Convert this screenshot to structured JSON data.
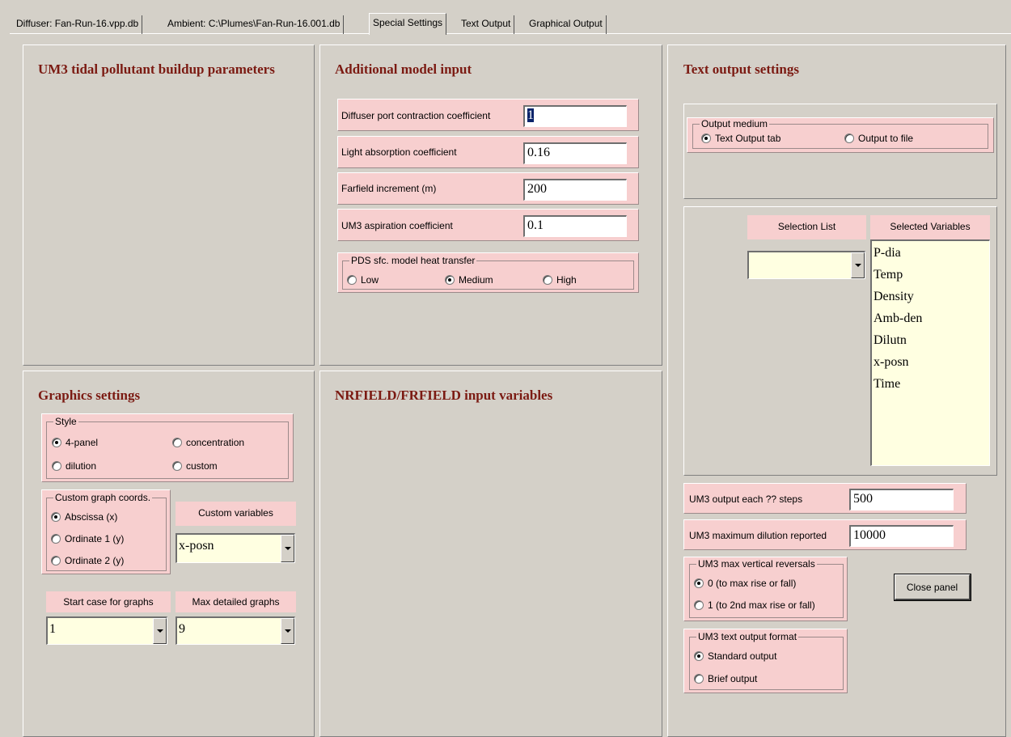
{
  "tabs": [
    {
      "label": "Diffuser: Fan-Run-16.vpp.db"
    },
    {
      "label": "Ambient: C:\\Plumes\\Fan-Run-16.001.db"
    },
    {
      "label": "Special Settings"
    },
    {
      "label": "Text Output"
    },
    {
      "label": "Graphical Output"
    }
  ],
  "um3_tidal": {
    "title": "UM3 tidal pollutant buildup parameters"
  },
  "additional": {
    "title": "Additional model input",
    "fields": [
      {
        "label": "Diffuser port contraction coefficient",
        "value": "1"
      },
      {
        "label": "Light absorption coefficient",
        "value": "0.16"
      },
      {
        "label": "Farfield increment (m)",
        "value": "200"
      },
      {
        "label": "UM3 aspiration coefficient",
        "value": "0.1"
      }
    ],
    "heat": {
      "legend": "PDS sfc. model heat transfer",
      "options": [
        "Low",
        "Medium",
        "High"
      ],
      "selected": "Medium"
    }
  },
  "text_output": {
    "title": "Text output settings",
    "medium": {
      "legend": "Output medium",
      "options": [
        "Text Output tab",
        "Output to file"
      ],
      "selected": "Text Output tab"
    },
    "selection_list_label": "Selection List",
    "selection_list_value": "",
    "selected_variables_label": "Selected Variables",
    "selected_variables": [
      "P-dia",
      "Temp",
      "Density",
      "Amb-den",
      "Dilutn",
      "x-posn",
      "Time"
    ],
    "steps": {
      "label": "UM3 output each ?? steps",
      "value": "500"
    },
    "max_dilution": {
      "label": "UM3 maximum dilution reported",
      "value": "10000"
    },
    "reversals": {
      "legend": "UM3 max vertical reversals",
      "options": [
        "0 (to max rise or fall)",
        "1 (to 2nd max rise or fall)"
      ],
      "selected": "0 (to max rise or fall)"
    },
    "format": {
      "legend": "UM3 text output format",
      "options": [
        "Standard output",
        "Brief output"
      ],
      "selected": "Standard output"
    },
    "close_label": "Close panel"
  },
  "graphics": {
    "title": "Graphics settings",
    "style": {
      "legend": "Style",
      "options": [
        "4-panel",
        "concentration",
        "dilution",
        "custom"
      ],
      "selected": "4-panel"
    },
    "coords": {
      "legend": "Custom graph coords.",
      "options": [
        "Abscissa (x)",
        "Ordinate 1 (y)",
        "Ordinate 2 (y)"
      ],
      "selected": "Abscissa (x)"
    },
    "custom_vars_label": "Custom variables",
    "custom_vars_value": "x-posn",
    "start_case_label": "Start case for graphs",
    "start_case_value": "1",
    "max_graphs_label": "Max detailed graphs",
    "max_graphs_value": "9"
  },
  "nrfield": {
    "title": "NRFIELD/FRFIELD input variables"
  }
}
